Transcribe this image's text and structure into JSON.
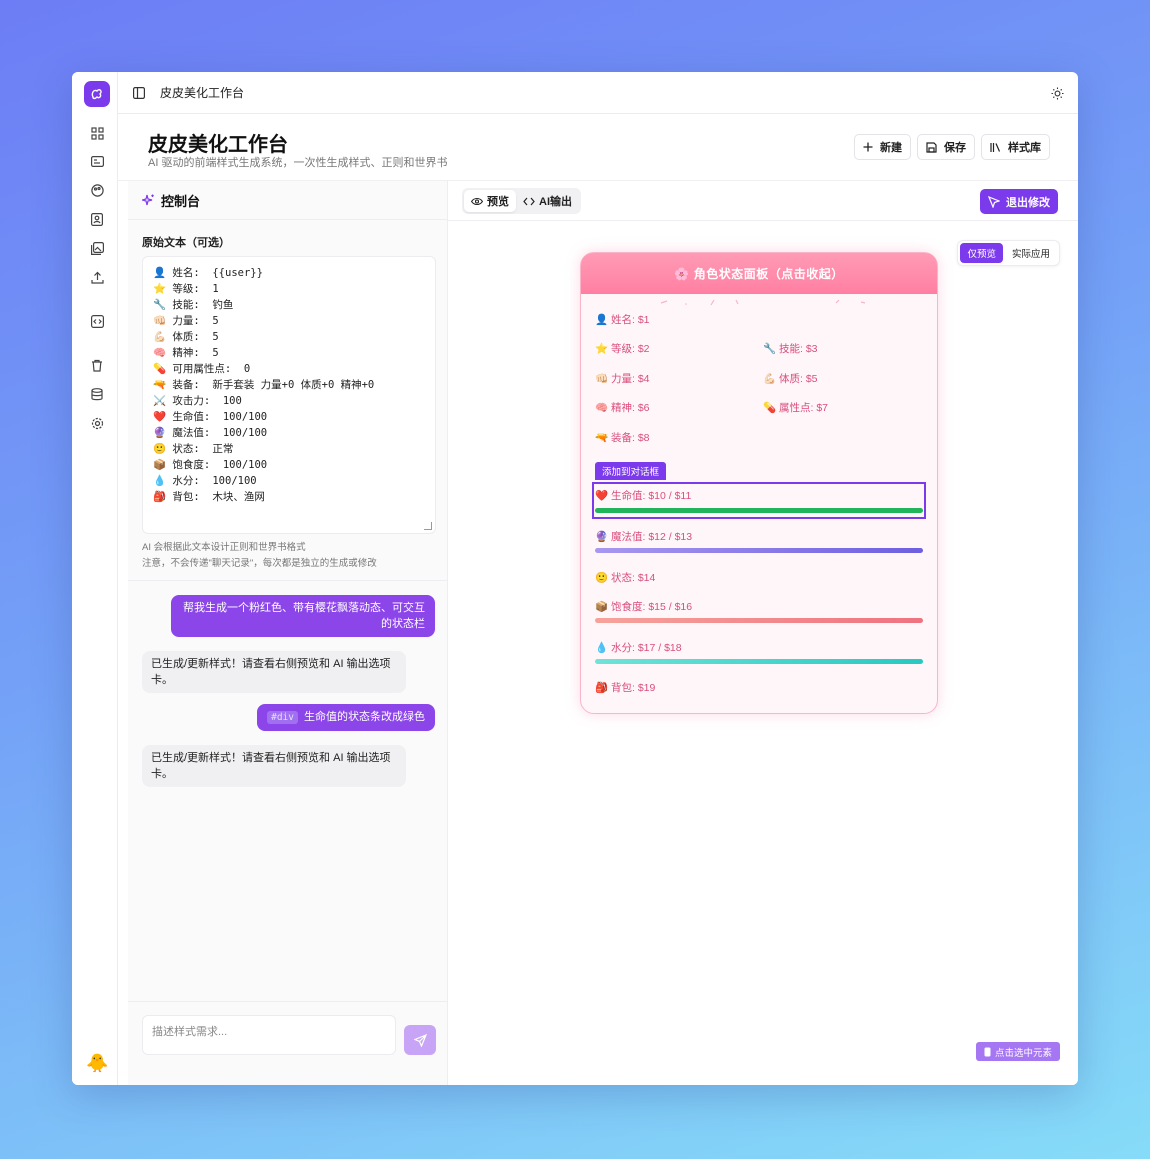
{
  "app": {
    "title": "皮皮美化工作台",
    "crumb": "皮皮美化工作台",
    "subtitle": "AI 驱动的前端样式生成系统，一次性生成样式、正则和世界书"
  },
  "header_buttons": {
    "new": "新建",
    "save": "保存",
    "library": "样式库"
  },
  "rail_icons": [
    "grid-icon",
    "id-card-icon",
    "palette-icon",
    "contact-icon",
    "images-icon",
    "upload-icon",
    "code-icon",
    "trash-icon",
    "database-icon",
    "settings-icon"
  ],
  "console": {
    "title": "控制台",
    "raw_label": "原始文本（可选）",
    "raw_lines": [
      "👤 姓名:  {{user}}",
      "⭐ 等级:  1",
      "🔧 技能:  钓鱼",
      "👊🏻 力量:  5",
      "💪🏻 体质:  5",
      "🧠 精神:  5",
      "💊 可用属性点:  0",
      "🔫 装备:  新手套装 力量+0 体质+0 精神+0",
      "⚔️ 攻击力:  100",
      "❤️ 生命值:  100/100",
      "🔮 魔法值:  100/100",
      "🙂 状态:  正常",
      "📦 饱食度:  100/100",
      "💧 水分:  100/100",
      "🎒 背包:  木块、渔网"
    ],
    "hint1": "AI 会根据此文本设计正则和世界书格式",
    "hint2": "注意，不会传递\"聊天记录\"，每次都是独立的生成或修改",
    "messages": {
      "user1": "帮我生成一个粉红色、带有樱花飘落动态、可交互的状态栏",
      "ai1": "已生成/更新样式！请查看右侧预览和 AI 输出选项卡。",
      "user2_tag": "#div",
      "user2": "生命值的状态条改成绿色",
      "ai2": "已生成/更新样式！请查看右侧预览和 AI 输出选项卡。"
    },
    "input_placeholder": "描述样式需求..."
  },
  "preview": {
    "tabs": {
      "preview": "预览",
      "ai_output": "AI输出"
    },
    "exit_button": "退出修改",
    "modes": {
      "preview_only": "仅预览",
      "apply": "实际应用"
    },
    "add_to_dialog": "添加到对话框",
    "pick_button": "点击选中元素",
    "card": {
      "title": "角色状态面板（点击收起）",
      "name": "👤 姓名: $1",
      "level": "⭐ 等级: $2",
      "skill": "🔧 技能: $3",
      "power": "👊🏻 力量: $4",
      "body": "💪🏻 体质: $5",
      "mind": "🧠 精神: $6",
      "points": "💊 属性点: $7",
      "equip": "🔫 装备: $8",
      "hp": "❤️ 生命值: $10 / $11",
      "mp": "🔮 魔法值: $12 / $13",
      "state": "🙂 状态: $14",
      "food": "📦 饱食度: $15 / $16",
      "water": "💧 水分: $17 / $18",
      "bag": "🎒 背包: $19"
    }
  },
  "colors": {
    "accent": "#7c3aed",
    "pink": "#ff7fa2",
    "hp_bar": "#22b45a",
    "mp_bar": "#7b6fe3",
    "food_bar": "#f07a80",
    "water_bar": "#3dd6cc"
  }
}
